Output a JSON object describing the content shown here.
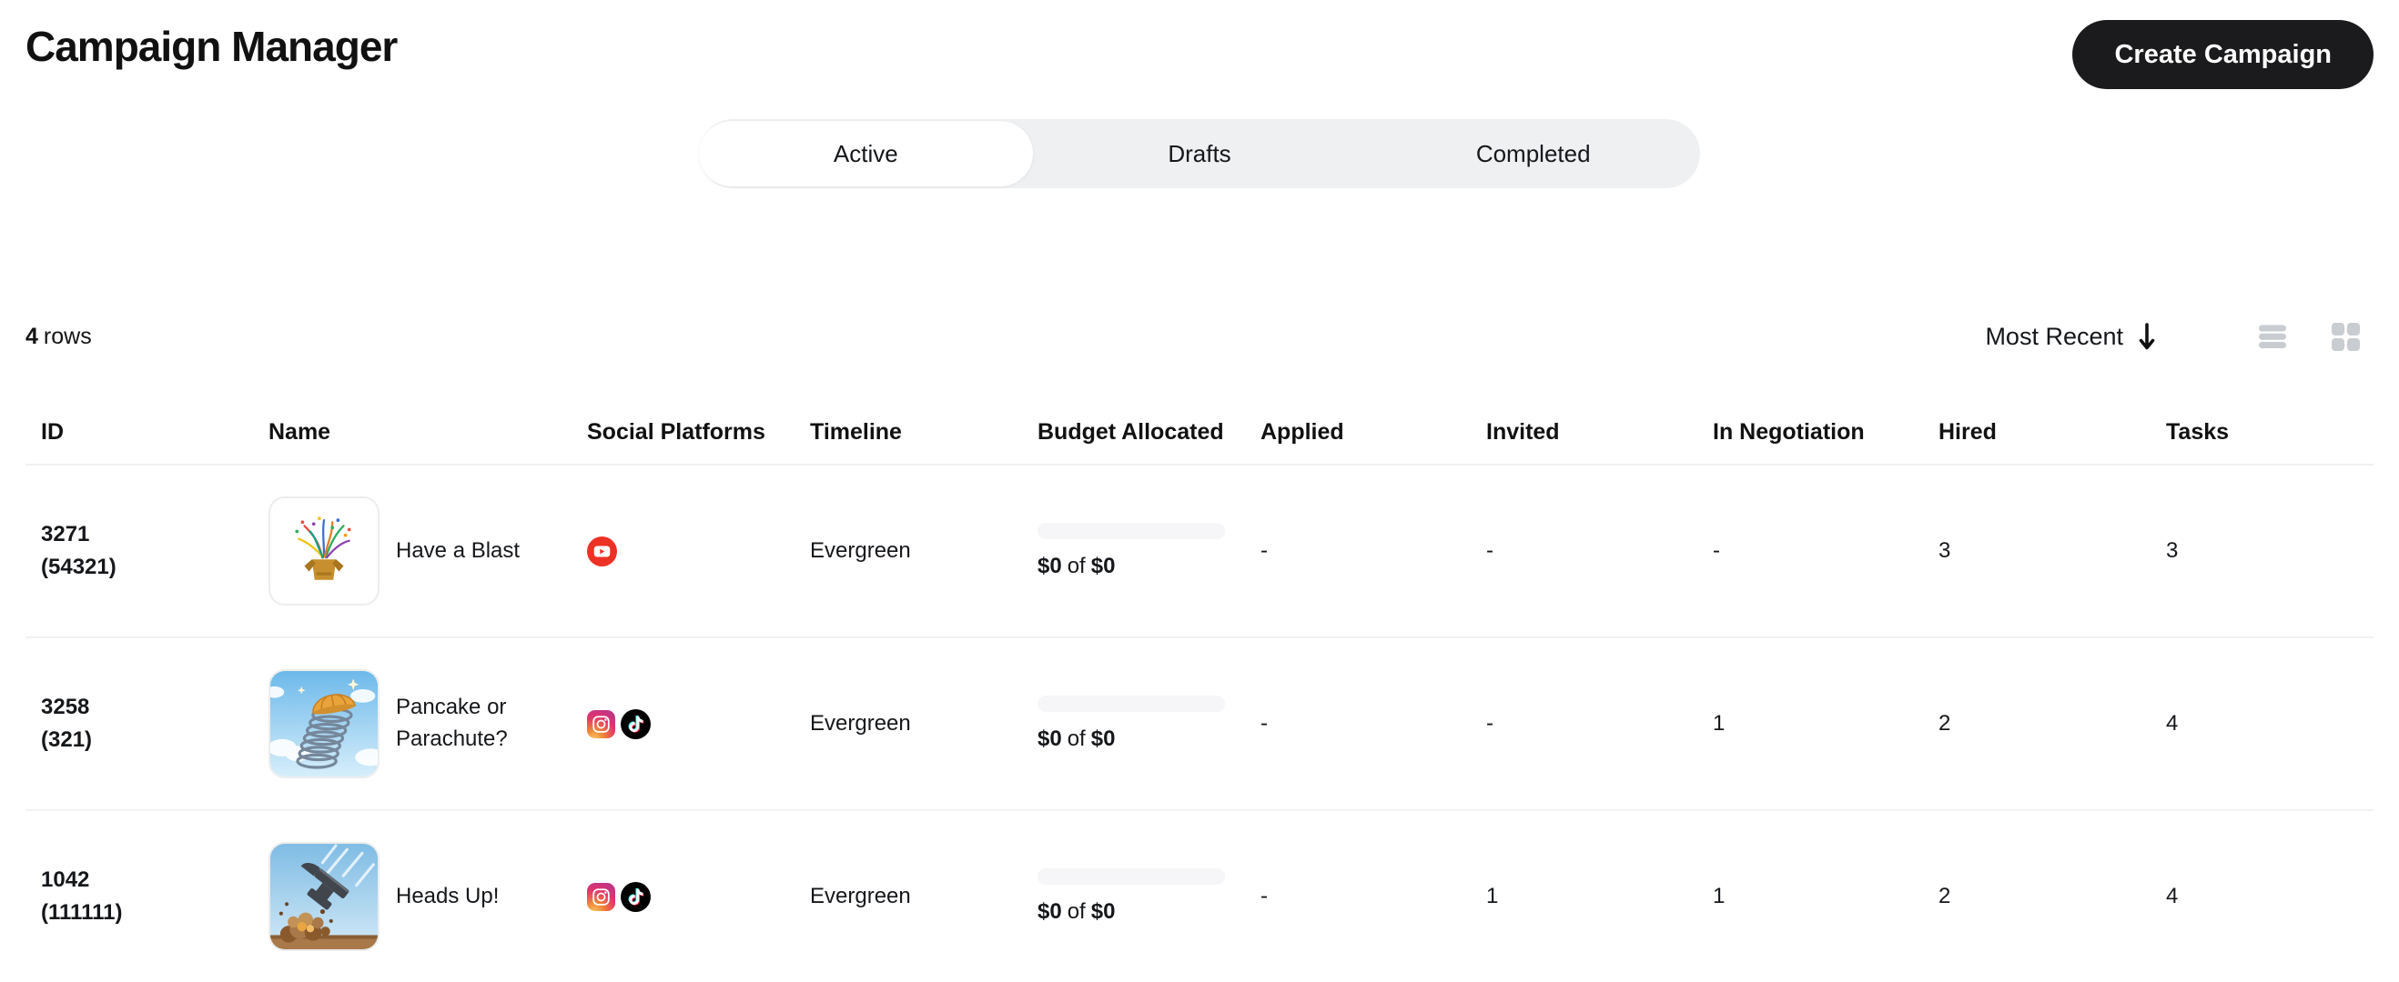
{
  "page": {
    "title": "Campaign Manager"
  },
  "header": {
    "create_button_label": "Create Campaign"
  },
  "tabs": [
    {
      "label": "Active",
      "active": true
    },
    {
      "label": "Drafts",
      "active": false
    },
    {
      "label": "Completed",
      "active": false
    }
  ],
  "controls": {
    "row_count": "4",
    "row_count_label": "rows",
    "sort_label": "Most Recent",
    "sort_direction": "descending"
  },
  "table": {
    "columns": [
      "ID",
      "Name",
      "Social Platforms",
      "Timeline",
      "Budget Allocated",
      "Applied",
      "Invited",
      "In Negotiation",
      "Hired",
      "Tasks"
    ],
    "rows": [
      {
        "id": "3271",
        "secondary_id": "(54321)",
        "name": "Have a Blast",
        "platforms": [
          "YouTube"
        ],
        "timeline": "Evergreen",
        "budget": {
          "spent": "$0",
          "conj": "of",
          "total": "$0",
          "progress_pct": 0
        },
        "applied": "-",
        "invited": "-",
        "in_negotiation": "-",
        "hired": "3",
        "tasks": "3"
      },
      {
        "id": "3258",
        "secondary_id": "(321)",
        "name": "Pancake or Parachute?",
        "platforms": [
          "Instagram",
          "TikTok"
        ],
        "timeline": "Evergreen",
        "budget": {
          "spent": "$0",
          "conj": "of",
          "total": "$0",
          "progress_pct": 0
        },
        "applied": "-",
        "invited": "-",
        "in_negotiation": "1",
        "hired": "2",
        "tasks": "4"
      },
      {
        "id": "1042",
        "secondary_id": "(111111)",
        "name": "Heads Up!",
        "platforms": [
          "Instagram",
          "TikTok"
        ],
        "timeline": "Evergreen",
        "budget": {
          "spent": "$0",
          "conj": "of",
          "total": "$0",
          "progress_pct": 0
        },
        "applied": "-",
        "invited": "1",
        "in_negotiation": "1",
        "hired": "2",
        "tasks": "4"
      }
    ]
  },
  "colors": {
    "button_bg": "#1b1b1d",
    "tab_bar_bg": "#eef0f2",
    "active_tab_bg": "#ffffff",
    "divider": "#f0f0f2",
    "progress_track": "#f6f6f8",
    "muted_icon": "#c9cdd2",
    "youtube_red": "#ed3124",
    "tiktok_black": "#010101",
    "instagram_gradient": [
      "#f7c95e",
      "#e3336d",
      "#b62e93"
    ]
  }
}
